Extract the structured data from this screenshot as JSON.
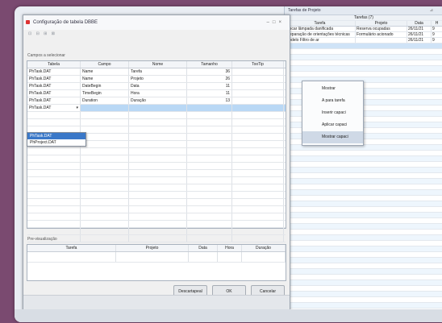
{
  "right_window": {
    "title": "Tarefas de Projeto",
    "pin_icon": "pin-icon",
    "group_header": "Tarefas (7)",
    "columns": [
      "Tarefa",
      "Projeto",
      "Data",
      "H"
    ],
    "rows": [
      [
        "Trocar lâmpada danificada",
        "Reserva ocupadas",
        "26/11/21",
        "9"
      ],
      [
        "Preparação de orientações técnicas",
        "Formulário acionado",
        "26/11/21",
        "9"
      ],
      [
        "Modelo Filtro de ar",
        "",
        "26/11/21",
        "9"
      ]
    ]
  },
  "context_menu": {
    "items": [
      "Mostrar",
      "A para tarefa",
      "Inserir capaci",
      "Aplicar capaci",
      "Mostrar capaci"
    ],
    "highlighted_index": 4
  },
  "dialog": {
    "title": "Configuração de tabela DBBE",
    "toolbar_icons": "⊡ ⊟ ⊞ ⊠",
    "section1": "Campos a selecionar",
    "grid1": {
      "columns": [
        "Tabela",
        "Campo",
        "Nome",
        "Tamanho",
        "TooTip"
      ],
      "rows": [
        [
          "PhTask.DAT",
          "Name",
          "Tarefa",
          "36",
          ""
        ],
        [
          "PhTask.DAT",
          "Name",
          "Projeto",
          "26",
          ""
        ],
        [
          "PhTask.DAT",
          "DateBegin",
          "Data",
          "11",
          ""
        ],
        [
          "PhTask.DAT",
          "TimeBegin",
          "Hora",
          "11",
          ""
        ],
        [
          "PhTask.DAT",
          "Duration",
          "Duração",
          "13",
          ""
        ]
      ],
      "editing_row": "PhTask.DAT",
      "dropdown_options": [
        "PhTask.DAT",
        "PhProject.DAT"
      ],
      "dropdown_selected_index": 0
    },
    "section2": "Pre-visualização",
    "grid2": {
      "columns": [
        "Tarefa",
        "Projeto",
        "Data",
        "Hora",
        "Duração"
      ]
    },
    "buttons": {
      "default": "Descartapeal",
      "ok": "OK",
      "cancel": "Cancelar"
    }
  }
}
